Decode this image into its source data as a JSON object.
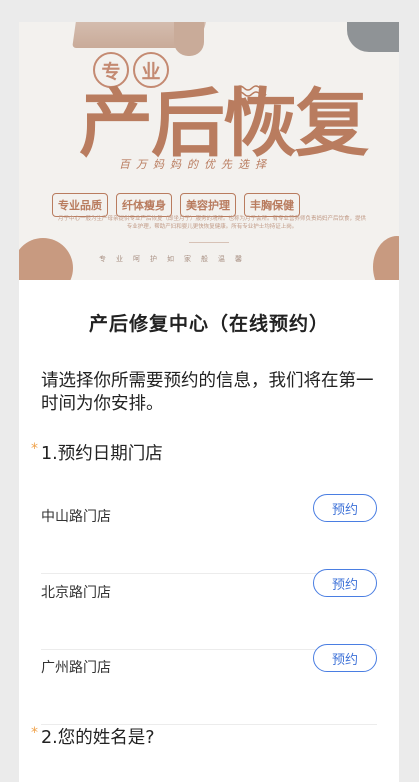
{
  "banner": {
    "seal_chars": [
      "专",
      "业"
    ],
    "headline": "产后恢复",
    "slogan": "百万妈妈的优先选择",
    "tags": [
      "专业品质",
      "纤体瘦身",
      "美容护理",
      "丰胸保健"
    ],
    "description": "月子中心一般为生产母亲提供专业产后恢复（即坐月子）服务的场所。也称为月子会所。有专业营养师负责妈妈产后饮食，提供专业护理，帮助产妇和婴儿更快恢复健康。所有专业护士均持证上岗。",
    "motto": "专业呵护如家般温馨"
  },
  "page": {
    "title": "产后修复中心（在线预约）",
    "intro": "请选择你所需要预约的信息，我们将在第一时间为你安排。",
    "required_mark": "*"
  },
  "questions": [
    {
      "label": "1.预约日期门店"
    },
    {
      "label": "2.您的姓名是?"
    }
  ],
  "stores": [
    {
      "name": "中山路门店",
      "button": "预约"
    },
    {
      "name": "北京路门店",
      "button": "预约"
    },
    {
      "name": "广州路门店",
      "button": "预约"
    }
  ],
  "colors": {
    "banner_brown": "#b97c5f",
    "accent_blue": "#3f73d8",
    "required_orange": "#f0a24a"
  }
}
